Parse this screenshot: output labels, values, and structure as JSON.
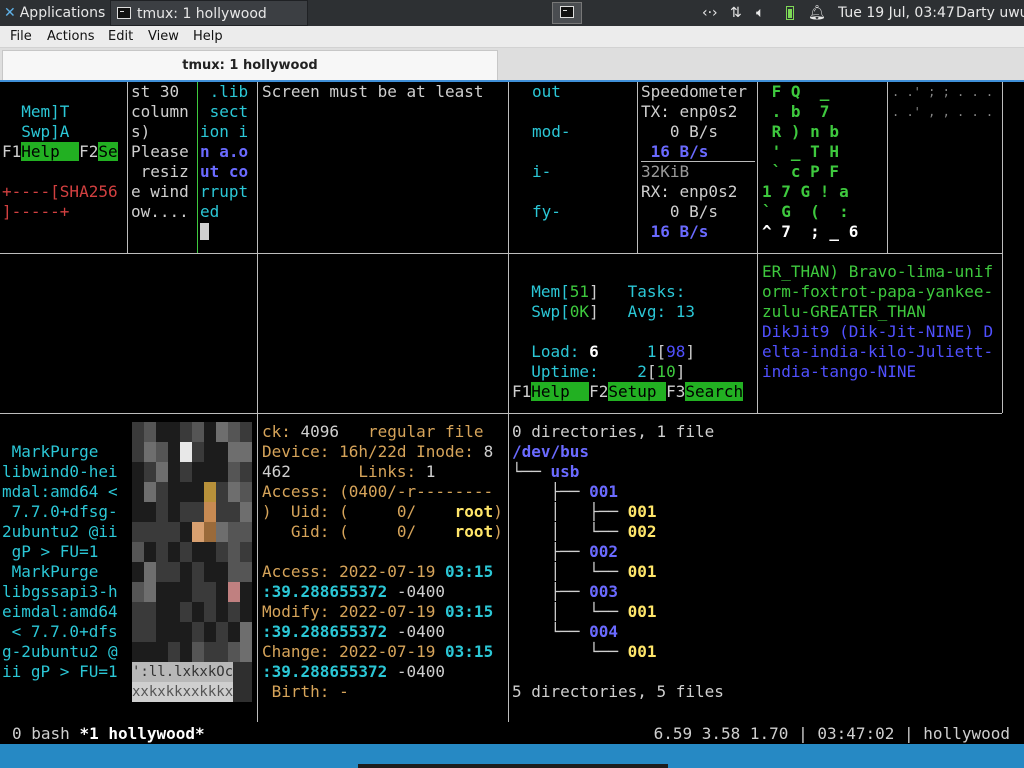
{
  "panel": {
    "applications": "Applications",
    "task_title": "tmux: 1 hollywood",
    "clock": "Tue 19 Jul, 03:47",
    "user": "Darty uwu"
  },
  "menubar": {
    "file": "File",
    "actions": "Actions",
    "edit": "Edit",
    "view": "View",
    "help": "Help"
  },
  "tab": {
    "title": "tmux: 1 hollywood"
  },
  "htop_small": [
    "  Mem]T",
    "  Swp]A"
  ],
  "htop_small_keys": {
    "f1": "F1",
    "help": "Help  ",
    "f2": "F2",
    "setup": "Se"
  },
  "hash_line1": "+----[SHA256",
  "hash_line2": "]-----+",
  "resize_msg": [
    "st 30",
    "column",
    "s)",
    "Please",
    " resiz",
    "e wind",
    "ow...."
  ],
  "lib_msg": [
    " .lib",
    " sect",
    "ion i",
    "n a.o",
    "ut co",
    "rrupt",
    "ed"
  ],
  "screen_msg": "Screen must be at least",
  "words_col": [
    "out",
    "",
    "mod-",
    "",
    "i-",
    "",
    "fy-"
  ],
  "speedo": {
    "title": "Speedometer",
    "tx": "TX: enp0s2",
    "tx_val": "   0 B/s",
    "tx_peak": " 16 B/s",
    "scale": "32KiB",
    "rx": "RX: enp0s2",
    "rx_val": "   0 B/s",
    "rx_peak": " 16 B/s"
  },
  "matrix_rows": [
    " F Q  _",
    " . b  7",
    " R ) n b",
    " ' _ T H",
    " ` c P F",
    "1 7 G ! a",
    "` G  (  :",
    "^ 7  ; _ 6"
  ],
  "matrix_dim": [
    ". .' ; ; . . . .",
    ". .' , , . . .",
    "",
    "",
    "",
    "",
    "",
    ""
  ],
  "htop": {
    "mem_label": "Mem[",
    "mem_val": "51",
    "swp_label": "Swp[",
    "swp_val": "0K",
    "tasks": "Tasks:",
    "avg_label": "Avg:",
    "avg_val": "13",
    "load_label": "Load:",
    "load_val": "6",
    "cpu1": "1",
    "cpu1_val": "98",
    "uptime_label": "Uptime:",
    "cpu2": "2",
    "cpu2_val": "10",
    "f1": "F1",
    "help": "Help  ",
    "f2": "F2",
    "setup": "Setup ",
    "f3": "F3",
    "search": "Search"
  },
  "phonetic": {
    "lines_a": [
      "ER_THAN) Bravo-lima-unif",
      "orm-foxtrot-papa-yankee-",
      "zulu-GREATER_THAN"
    ],
    "lines_b": [
      "DikJit9 (Dik-Jit-NINE) D",
      "elta-india-kilo-Juliett-",
      "india-tango-NINE"
    ]
  },
  "dpkg_lines": [
    " MarkPurge",
    "libwind0-hei",
    "mdal:amd64 <",
    " 7.7.0+dfsg-",
    "2ubuntu2 @ii",
    " gP > FU=1",
    " MarkPurge",
    "libgssapi3-h",
    "eimdal:amd64",
    " < 7.7.0+dfs",
    "g-2ubuntu2 @",
    "ii gP > FU=1"
  ],
  "pixart_text": [
    "':ll.lxkxkOc",
    "xxkxkkxxkkkx"
  ],
  "stat": {
    "block_label": "ck: ",
    "block_val": "4096",
    "type": "   regular file",
    "device_label": "Device: ",
    "device_val": "16h/22d",
    "inode_label": " Inode: ",
    "inode_val1": "8",
    "inode_val2": "462",
    "links_label": "       Links: ",
    "links_val": "1",
    "access1": "Access: (0400/-r--------",
    "uid_pre": ")  Uid: (     0/    ",
    "uid_val": "root",
    "uid_post": ")",
    "gid_pre": "   Gid: (     0/    ",
    "gid_val": "root",
    "gid_post": ")",
    "access2_label": "Access: 2022-07-19 ",
    "access2_time": "03:15",
    "access2_sec": ":39.288655372",
    "tz": " -0400",
    "modify_label": "Modify: 2022-07-19 ",
    "modify_time": "03:15",
    "modify_sec": ":39.288655372",
    "change_label": "Change: 2022-07-19 ",
    "change_time": "03:15",
    "change_sec": ":39.288655372",
    "birth": " Birth: -"
  },
  "tree": {
    "summary_top": "0 directories, 1 file",
    "root": "/dev/bus",
    "lines": [
      {
        "prefix": "└── ",
        "name": "usb",
        "cls": "bb"
      },
      {
        "prefix": "    ├── ",
        "name": "001",
        "cls": "bb"
      },
      {
        "prefix": "    │   ├── ",
        "name": "001",
        "cls": "yl"
      },
      {
        "prefix": "    │   └── ",
        "name": "002",
        "cls": "yl"
      },
      {
        "prefix": "    ├── ",
        "name": "002",
        "cls": "bb"
      },
      {
        "prefix": "    │   └── ",
        "name": "001",
        "cls": "yl"
      },
      {
        "prefix": "    ├── ",
        "name": "003",
        "cls": "bb"
      },
      {
        "prefix": "    │   └── ",
        "name": "001",
        "cls": "yl"
      },
      {
        "prefix": "    └── ",
        "name": "004",
        "cls": "bb"
      },
      {
        "prefix": "        └── ",
        "name": "001",
        "cls": "yl"
      }
    ],
    "summary_bottom": "5 directories, 5 files"
  },
  "status": {
    "left": "0 bash ",
    "active": "*1 hollywood*",
    "right": "6.59 3.58 1.70 | 03:47:02 | hollywood"
  },
  "colors": {
    "accent": "#2689c4",
    "tab_line": "#3f8fd8",
    "panel": "#2d3033",
    "green_key": "#22b022"
  }
}
